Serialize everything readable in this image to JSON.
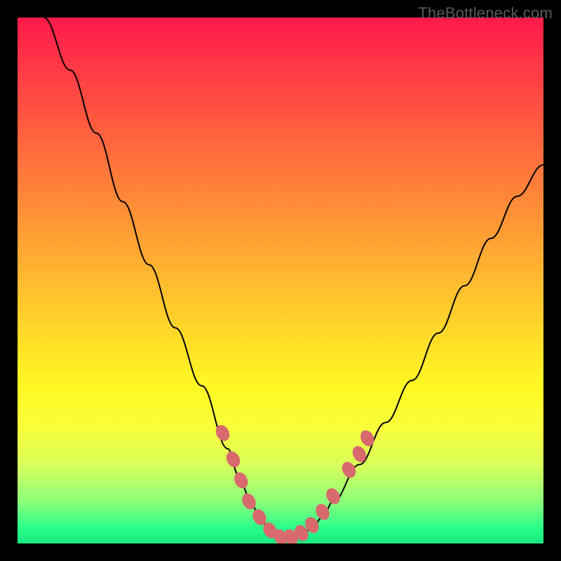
{
  "watermark": "TheBottleneck.com",
  "chart_data": {
    "type": "line",
    "title": "",
    "xlabel": "",
    "ylabel": "",
    "xlim": [
      0,
      100
    ],
    "ylim": [
      0,
      100
    ],
    "background_gradient": {
      "top_color": "#ff1a4b",
      "bottom_color": "#17e880",
      "description": "red-orange-yellow-green vertical gradient"
    },
    "series": [
      {
        "name": "bottleneck-curve",
        "description": "Black V-shaped curve with minimum near center; left branch steeper, originating near top-left; right branch shallower, reaching ~70% height at right edge.",
        "x": [
          5,
          10,
          15,
          20,
          25,
          30,
          35,
          40,
          42,
          44,
          46,
          48,
          50,
          52,
          54,
          56,
          58,
          60,
          65,
          70,
          75,
          80,
          85,
          90,
          95,
          100
        ],
        "y": [
          100,
          90,
          78,
          65,
          53,
          41,
          30,
          18,
          13,
          9,
          5,
          2.5,
          1,
          1,
          1.5,
          3,
          5,
          8,
          15,
          23,
          31,
          40,
          49,
          58,
          66,
          72
        ]
      }
    ],
    "markers": {
      "description": "Salmon-colored oval markers clustered near the curve bottom on both branches",
      "color": "#d86a6e",
      "points": [
        {
          "x": 39,
          "y": 21
        },
        {
          "x": 41,
          "y": 16
        },
        {
          "x": 42.5,
          "y": 12
        },
        {
          "x": 44,
          "y": 8
        },
        {
          "x": 46,
          "y": 5
        },
        {
          "x": 48,
          "y": 2.5
        },
        {
          "x": 50,
          "y": 1.2
        },
        {
          "x": 52,
          "y": 1.2
        },
        {
          "x": 54,
          "y": 2
        },
        {
          "x": 56,
          "y": 3.5
        },
        {
          "x": 58,
          "y": 6
        },
        {
          "x": 60,
          "y": 9
        },
        {
          "x": 63,
          "y": 14
        },
        {
          "x": 65,
          "y": 17
        },
        {
          "x": 66.5,
          "y": 20
        }
      ]
    }
  }
}
